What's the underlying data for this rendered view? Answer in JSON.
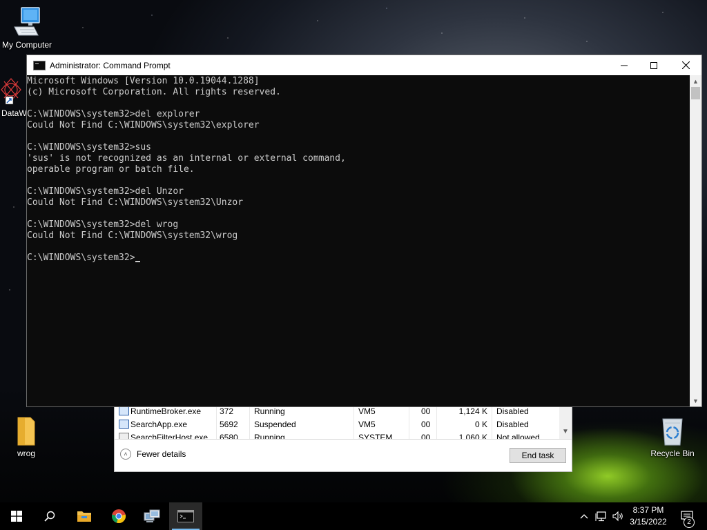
{
  "desktop": {
    "icons": {
      "my_computer": "My Computer",
      "datawc": "DataWC",
      "wrog": "wrog",
      "recycle_bin": "Recycle Bin"
    }
  },
  "cmd": {
    "title": "Administrator: Command Prompt",
    "lines": [
      "Microsoft Windows [Version 10.0.19044.1288]",
      "(c) Microsoft Corporation. All rights reserved.",
      "",
      "C:\\WINDOWS\\system32>del explorer",
      "Could Not Find C:\\WINDOWS\\system32\\explorer",
      "",
      "C:\\WINDOWS\\system32>sus",
      "'sus' is not recognized as an internal or external command,",
      "operable program or batch file.",
      "",
      "C:\\WINDOWS\\system32>del Unzor",
      "Could Not Find C:\\WINDOWS\\system32\\Unzor",
      "",
      "C:\\WINDOWS\\system32>del wrog",
      "Could Not Find C:\\WINDOWS\\system32\\wrog",
      ""
    ],
    "prompt": "C:\\WINDOWS\\system32>"
  },
  "taskmgr": {
    "rows": [
      {
        "name": "RuntimeBroker.exe",
        "pid": "372",
        "status": "Running",
        "user": "VM5",
        "cpu": "00",
        "memory": "1,124 K",
        "uac": "Disabled"
      },
      {
        "name": "SearchApp.exe",
        "pid": "5692",
        "status": "Suspended",
        "user": "VM5",
        "cpu": "00",
        "memory": "0 K",
        "uac": "Disabled"
      },
      {
        "name": "SearchFilterHost.exe",
        "pid": "6580",
        "status": "Running",
        "user": "SYSTEM",
        "cpu": "00",
        "memory": "1,060 K",
        "uac": "Not allowed"
      }
    ],
    "fewer_details": "Fewer details",
    "end_task": "End task"
  },
  "taskbar": {
    "time": "8:37 PM",
    "date": "3/15/2022",
    "notification_count": "2"
  },
  "colors": {
    "console_bg": "#0c0c0c",
    "console_text": "#cccccc",
    "taskbar_bg": "#000000",
    "accent": "#76b9ed"
  }
}
